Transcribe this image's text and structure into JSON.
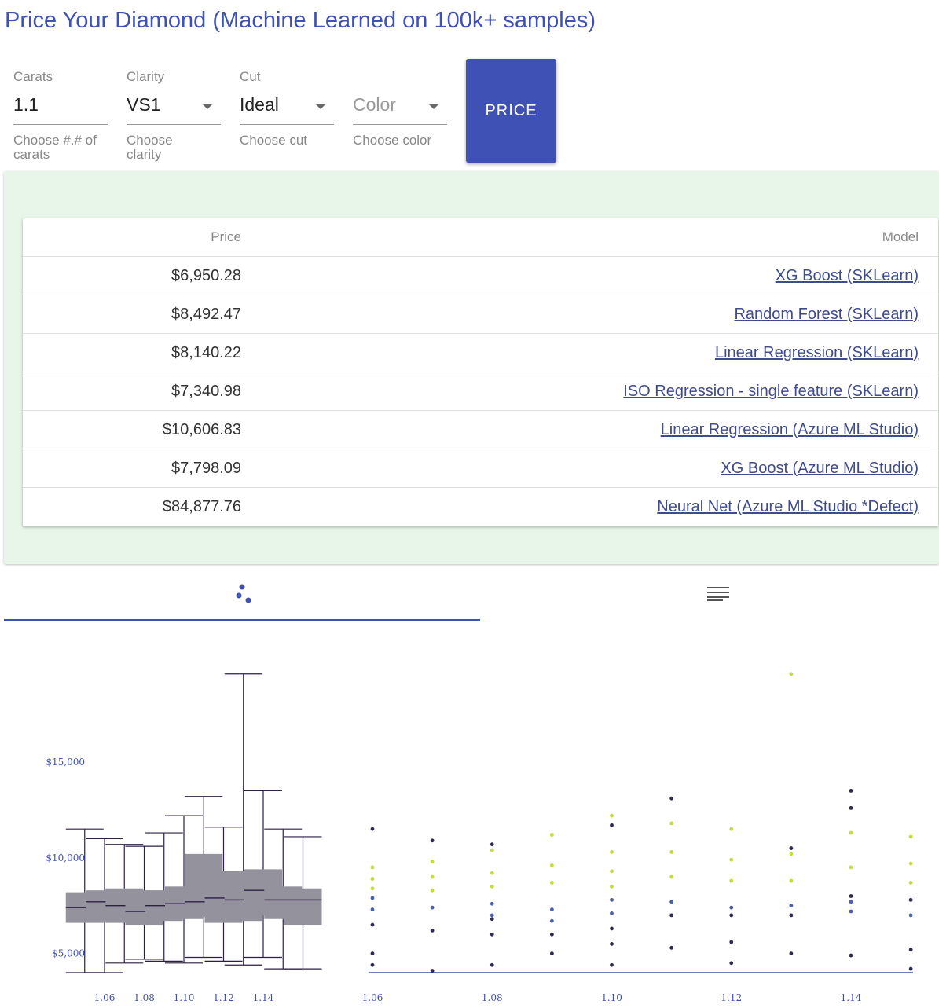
{
  "title": "Price Your Diamond (Machine Learned on 100k+ samples)",
  "form": {
    "carats": {
      "label": "Carats",
      "value": "1.1",
      "helper": "Choose #.# of carats"
    },
    "clarity": {
      "label": "Clarity",
      "value": "VS1",
      "helper": "Choose clarity"
    },
    "cut": {
      "label": "Cut",
      "value": "Ideal",
      "helper": "Choose cut"
    },
    "color": {
      "label": "",
      "placeholder": "Color",
      "helper": "Choose color"
    },
    "price_button": "PRICE"
  },
  "results": {
    "headers": {
      "price": "Price",
      "model": "Model"
    },
    "rows": [
      {
        "price": "$6,950.28",
        "model": "XG Boost (SKLearn)"
      },
      {
        "price": "$8,492.47",
        "model": "Random Forest (SKLearn)"
      },
      {
        "price": "$8,140.22",
        "model": "Linear Regression (SKLearn)"
      },
      {
        "price": "$7,340.98",
        "model": "ISO Regression - single feature (SKLearn)"
      },
      {
        "price": "$10,606.83",
        "model": "Linear Regression (Azure ML Studio)"
      },
      {
        "price": "$7,798.09",
        "model": "XG Boost (Azure ML Studio)"
      },
      {
        "price": "$84,877.76",
        "model": "Neural Net (Azure ML Studio *Defect)"
      }
    ]
  },
  "tabs": [
    {
      "icon": "scatter-dots-icon",
      "active": true
    },
    {
      "icon": "list-lines-icon",
      "active": false
    }
  ],
  "colors": {
    "accent": "#3f51b5",
    "panel": "#e8f5e9",
    "box": "#94929c",
    "line": "#2b1f45",
    "green": "#c6dc3a",
    "blue": "#4b5fb0",
    "navy": "#2e2a52"
  },
  "chart_data": [
    {
      "type": "box",
      "x_ticks": [
        "1.06",
        "1.08",
        "1.10",
        "1.12",
        "1.14"
      ],
      "y_ticks": [
        "$5,000",
        "$10,000",
        "$15,000"
      ],
      "ylim": [
        4000,
        20000
      ],
      "boxes": [
        {
          "x": 1.05,
          "min": 4000,
          "q1": 6600,
          "median": 7400,
          "q3": 8200,
          "max": 11500
        },
        {
          "x": 1.06,
          "min": 4000,
          "q1": 6700,
          "median": 7700,
          "q3": 8300,
          "max": 11000
        },
        {
          "x": 1.07,
          "min": 4500,
          "q1": 6600,
          "median": 7500,
          "q3": 8400,
          "max": 10700
        },
        {
          "x": 1.08,
          "min": 4700,
          "q1": 6500,
          "median": 7200,
          "q3": 8300,
          "max": 10600
        },
        {
          "x": 1.09,
          "min": 4600,
          "q1": 6700,
          "median": 7500,
          "q3": 8300,
          "max": 11300
        },
        {
          "x": 1.1,
          "min": 4500,
          "q1": 6800,
          "median": 7600,
          "q3": 8500,
          "max": 12200
        },
        {
          "x": 1.11,
          "min": 4800,
          "q1": 6900,
          "median": 7700,
          "q3": 10200,
          "max": 13200
        },
        {
          "x": 1.12,
          "min": 4600,
          "q1": 6600,
          "median": 7900,
          "q3": 9300,
          "max": 11600
        },
        {
          "x": 1.13,
          "min": 4400,
          "q1": 6700,
          "median": 7800,
          "q3": 9300,
          "max": 19600
        },
        {
          "x": 1.14,
          "min": 4800,
          "q1": 7000,
          "median": 8300,
          "q3": 9400,
          "max": 13500
        },
        {
          "x": 1.15,
          "min": 4200,
          "q1": 6800,
          "median": 7800,
          "q3": 8500,
          "max": 11500
        },
        {
          "x": 1.16,
          "min": 4200,
          "q1": 6500,
          "median": 7800,
          "q3": 8400,
          "max": 11100
        }
      ]
    },
    {
      "type": "scatter",
      "x_ticks": [
        "1.06",
        "1.08",
        "1.10",
        "1.12",
        "1.14"
      ],
      "xlim": [
        1.05,
        1.16
      ],
      "ylim": [
        4000,
        20000
      ],
      "series": [
        {
          "color": "navy",
          "points": [
            [
              1.06,
              11500
            ],
            [
              1.06,
              6500
            ],
            [
              1.06,
              5000
            ],
            [
              1.06,
              4400
            ],
            [
              1.07,
              10900
            ],
            [
              1.07,
              6200
            ],
            [
              1.07,
              4100
            ],
            [
              1.08,
              10700
            ],
            [
              1.08,
              6800
            ],
            [
              1.08,
              6000
            ],
            [
              1.08,
              4400
            ],
            [
              1.09,
              6000
            ],
            [
              1.09,
              5000
            ],
            [
              1.1,
              11700
            ],
            [
              1.1,
              6300
            ],
            [
              1.1,
              5500
            ],
            [
              1.1,
              4400
            ],
            [
              1.11,
              13100
            ],
            [
              1.11,
              7000
            ],
            [
              1.11,
              5300
            ],
            [
              1.12,
              7000
            ],
            [
              1.12,
              5600
            ],
            [
              1.12,
              4500
            ],
            [
              1.13,
              10500
            ],
            [
              1.13,
              7000
            ],
            [
              1.13,
              5000
            ],
            [
              1.14,
              13500
            ],
            [
              1.14,
              12600
            ],
            [
              1.14,
              8000
            ],
            [
              1.14,
              4900
            ],
            [
              1.15,
              7800
            ],
            [
              1.15,
              5200
            ],
            [
              1.15,
              4200
            ]
          ]
        },
        {
          "color": "blue",
          "points": [
            [
              1.06,
              7900
            ],
            [
              1.06,
              7300
            ],
            [
              1.07,
              7400
            ],
            [
              1.08,
              7600
            ],
            [
              1.08,
              7000
            ],
            [
              1.09,
              7300
            ],
            [
              1.09,
              6700
            ],
            [
              1.1,
              7800
            ],
            [
              1.1,
              7100
            ],
            [
              1.11,
              7700
            ],
            [
              1.12,
              7400
            ],
            [
              1.13,
              7500
            ],
            [
              1.14,
              7700
            ],
            [
              1.14,
              7200
            ],
            [
              1.15,
              7000
            ]
          ]
        },
        {
          "color": "green",
          "points": [
            [
              1.06,
              9500
            ],
            [
              1.06,
              8900
            ],
            [
              1.06,
              8400
            ],
            [
              1.07,
              9800
            ],
            [
              1.07,
              9000
            ],
            [
              1.07,
              8300
            ],
            [
              1.08,
              10400
            ],
            [
              1.08,
              9200
            ],
            [
              1.08,
              8500
            ],
            [
              1.09,
              11200
            ],
            [
              1.09,
              9600
            ],
            [
              1.09,
              8700
            ],
            [
              1.1,
              12200
            ],
            [
              1.1,
              10300
            ],
            [
              1.1,
              9300
            ],
            [
              1.1,
              8500
            ],
            [
              1.11,
              11800
            ],
            [
              1.11,
              10300
            ],
            [
              1.11,
              9000
            ],
            [
              1.12,
              11500
            ],
            [
              1.12,
              9900
            ],
            [
              1.12,
              8800
            ],
            [
              1.13,
              19600
            ],
            [
              1.13,
              10200
            ],
            [
              1.13,
              8800
            ],
            [
              1.14,
              11300
            ],
            [
              1.14,
              9500
            ],
            [
              1.15,
              11100
            ],
            [
              1.15,
              9700
            ],
            [
              1.15,
              8700
            ]
          ]
        }
      ]
    }
  ]
}
